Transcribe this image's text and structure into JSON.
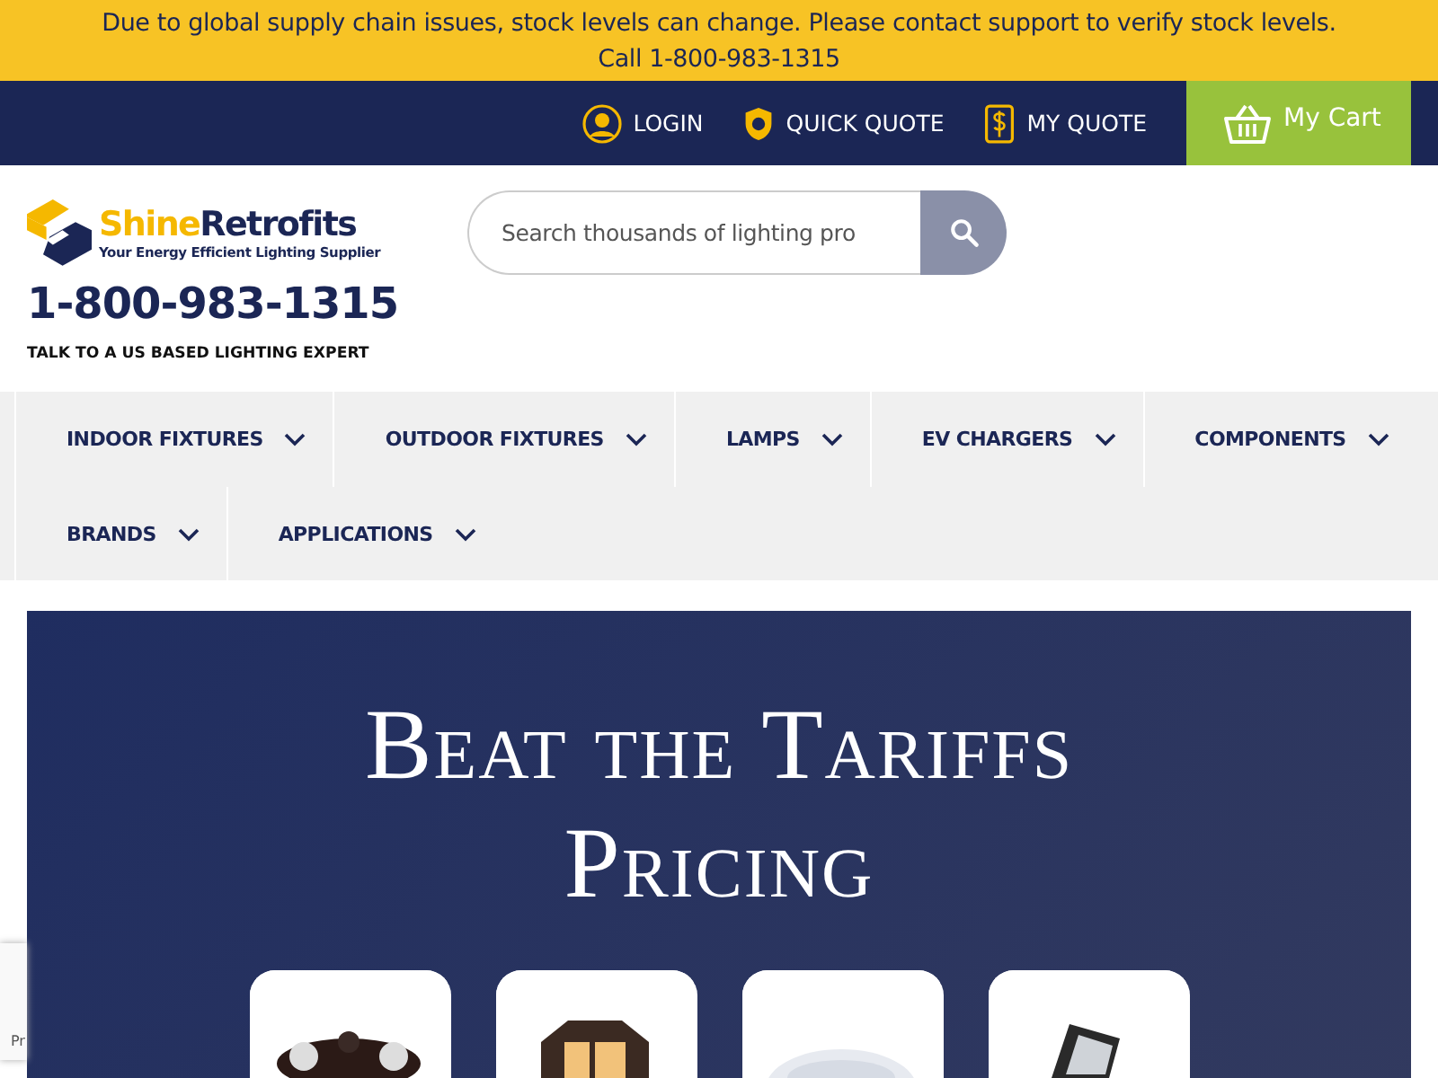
{
  "notice": {
    "text": "Due to global supply chain issues, stock levels can change. Please contact support to verify stock levels.",
    "phone": "Call 1-800-983-1315"
  },
  "account_links": [
    {
      "label": "LOGIN",
      "kind": "user"
    },
    {
      "label": "QUICK QUOTE",
      "kind": "shield"
    },
    {
      "label": "MY QUOTE",
      "kind": "document"
    }
  ],
  "cart": {
    "label": "My Cart"
  },
  "logo": {
    "name_part_1": "Shine",
    "name_part_2": "Retrofits",
    "tagline": "Your Energy Efficient Lighting Supplier"
  },
  "phone": "1-800-983-1315",
  "phone_caption": "TALK TO A US BASED LIGHTING EXPERT",
  "search": {
    "placeholder": "Search thousands of lighting pro"
  },
  "nav": [
    {
      "label": "INDOOR FIXTURES"
    },
    {
      "label": "OUTDOOR FIXTURES"
    },
    {
      "label": "LAMPS"
    },
    {
      "label": "EV CHARGERS"
    },
    {
      "label": "COMPONENTS"
    },
    {
      "label": "BRANDS"
    },
    {
      "label": "APPLICATIONS"
    }
  ],
  "banner": {
    "title_line_1": "Beat the Tariffs",
    "title_line_2": "Pricing"
  },
  "recaptcha_badge": {
    "text": "Pr"
  }
}
